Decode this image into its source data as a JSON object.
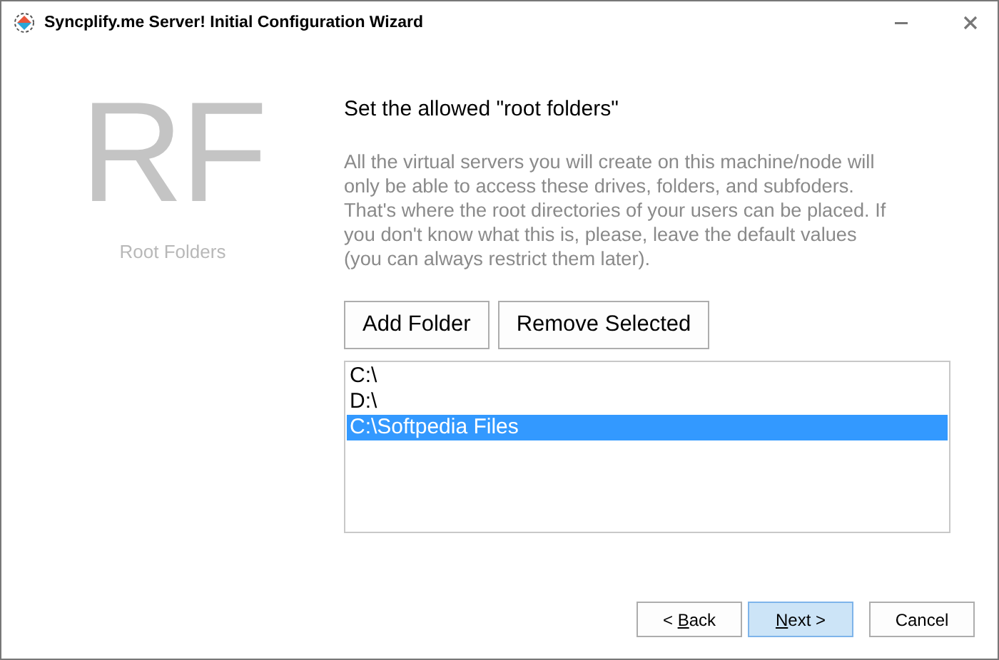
{
  "window": {
    "title": "Syncplify.me Server! Initial Configuration Wizard"
  },
  "sidebar": {
    "logo": "RF",
    "caption": "Root Folders"
  },
  "heading": "Set the allowed \"root folders\"",
  "description": "All the virtual servers you will create on this machine/node will only be able to access these drives, folders, and subfoders. That's where the root directories of your users can be placed. If you don't know what this is, please, leave the default values (you can always restrict them later).",
  "actions": [
    "Add Folder",
    "Remove Selected"
  ],
  "folders": [
    {
      "path": "C:\\",
      "selected": false
    },
    {
      "path": "D:\\",
      "selected": false
    },
    {
      "path": "C:\\Softpedia Files",
      "selected": true
    }
  ],
  "buttons": [
    {
      "pre": "< ",
      "key": "B",
      "post": "ack",
      "default": false
    },
    {
      "key": "N",
      "post": "ext >",
      "default": true
    },
    {
      "pre": "Cancel",
      "default": false
    }
  ]
}
